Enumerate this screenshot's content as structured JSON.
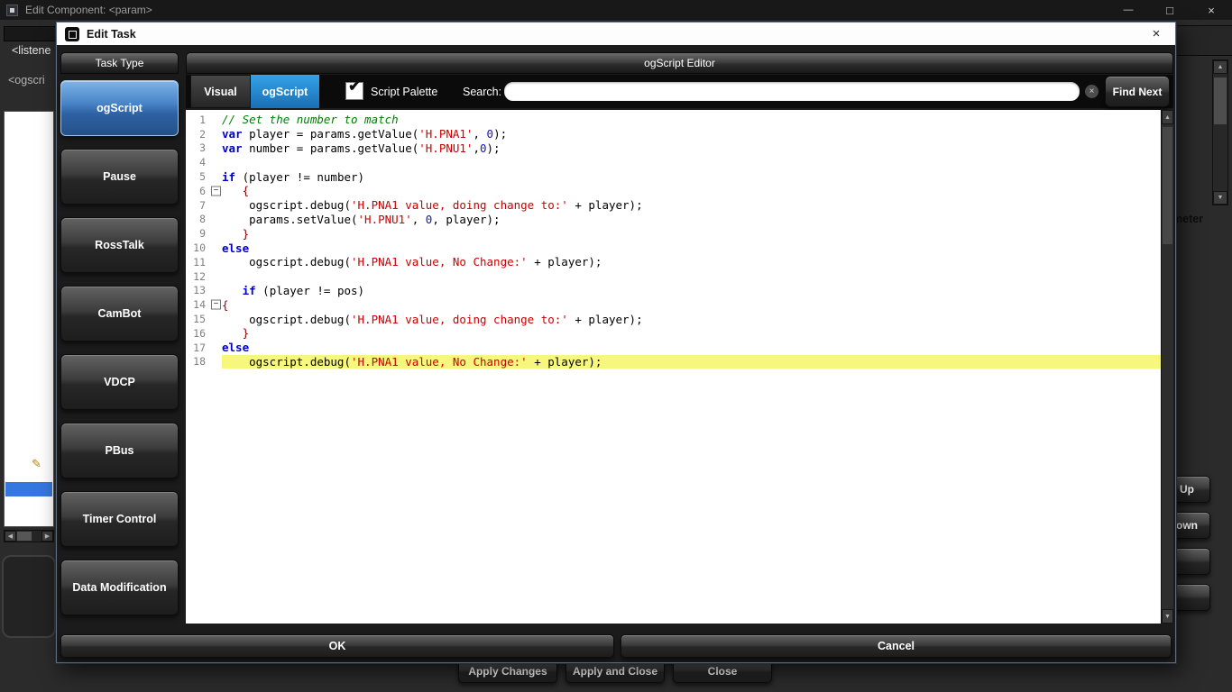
{
  "window": {
    "title": "Edit Component: <param>",
    "controls": {
      "minimize": "—",
      "maximize": "□",
      "close": "×"
    }
  },
  "icons": {
    "check": "✔",
    "clear": "×",
    "dialog_close": "×",
    "scroll_up": "▲",
    "scroll_down": "▼",
    "scroll_left": "◀",
    "scroll_right": "▶",
    "pencil": "✎"
  },
  "background": {
    "listener_text": "<listene",
    "ogscript_text": "<ogscri",
    "meter_text": "meter",
    "up_button": "Up",
    "down_button": "own",
    "bottom_buttons": [
      "Apply Changes",
      "Apply and Close",
      "Close"
    ]
  },
  "dialog": {
    "title": "Edit Task",
    "sidebar": {
      "header": "Task Type",
      "items": [
        {
          "label": "ogScript",
          "selected": true
        },
        {
          "label": "Pause",
          "selected": false
        },
        {
          "label": "RossTalk",
          "selected": false
        },
        {
          "label": "CamBot",
          "selected": false
        },
        {
          "label": "VDCP",
          "selected": false
        },
        {
          "label": "PBus",
          "selected": false
        },
        {
          "label": "Timer Control",
          "selected": false
        },
        {
          "label": "Data Modification",
          "selected": false
        }
      ]
    },
    "editor": {
      "header": "ogScript Editor",
      "tabs": [
        {
          "label": "Visual",
          "selected": false
        },
        {
          "label": "ogScript",
          "selected": true
        }
      ],
      "script_palette": {
        "label": "Script Palette",
        "checked": true
      },
      "search": {
        "label": "Search:",
        "value": ""
      },
      "find_next": "Find Next",
      "code": {
        "lines": [
          {
            "n": 1,
            "tokens": [
              [
                "cm",
                "// Set the number to match"
              ]
            ]
          },
          {
            "n": 2,
            "tokens": [
              [
                "kw",
                "var"
              ],
              [
                "pl",
                " player = params.getValue("
              ],
              [
                "str",
                "'H.PNA1'"
              ],
              [
                "pl",
                ", "
              ],
              [
                "num",
                "0"
              ],
              [
                "pl",
                ");"
              ]
            ]
          },
          {
            "n": 3,
            "tokens": [
              [
                "kw",
                "var"
              ],
              [
                "pl",
                " number = params.getValue("
              ],
              [
                "str",
                "'H.PNU1'"
              ],
              [
                "pl",
                ","
              ],
              [
                "num",
                "0"
              ],
              [
                "pl",
                ");"
              ]
            ]
          },
          {
            "n": 4,
            "tokens": []
          },
          {
            "n": 5,
            "tokens": [
              [
                "kw",
                "if"
              ],
              [
                "pl",
                " (player != number)"
              ]
            ]
          },
          {
            "n": 6,
            "fold": true,
            "tokens": [
              [
                "pn",
                "   {"
              ]
            ]
          },
          {
            "n": 7,
            "tokens": [
              [
                "pl",
                "    ogscript.debug("
              ],
              [
                "str",
                "'H.PNA1 value, doing change to:'"
              ],
              [
                "pl",
                " + player);"
              ]
            ]
          },
          {
            "n": 8,
            "tokens": [
              [
                "pl",
                "    params.setValue("
              ],
              [
                "str",
                "'H.PNU1'"
              ],
              [
                "pl",
                ", "
              ],
              [
                "num",
                "0"
              ],
              [
                "pl",
                ", player);"
              ]
            ]
          },
          {
            "n": 9,
            "tokens": [
              [
                "pn",
                "   }"
              ]
            ]
          },
          {
            "n": 10,
            "tokens": [
              [
                "kw",
                "else"
              ]
            ]
          },
          {
            "n": 11,
            "tokens": [
              [
                "pl",
                "    ogscript.debug("
              ],
              [
                "str",
                "'H.PNA1 value, No Change:'"
              ],
              [
                "pl",
                " + player);"
              ]
            ]
          },
          {
            "n": 12,
            "tokens": []
          },
          {
            "n": 13,
            "tokens": [
              [
                "pl",
                "   "
              ],
              [
                "kw",
                "if"
              ],
              [
                "pl",
                " (player != pos)"
              ]
            ]
          },
          {
            "n": 14,
            "fold": true,
            "tokens": [
              [
                "pn",
                "{"
              ]
            ]
          },
          {
            "n": 15,
            "tokens": [
              [
                "pl",
                "    ogscript.debug("
              ],
              [
                "str",
                "'H.PNA1 value, doing change to:'"
              ],
              [
                "pl",
                " + player);"
              ]
            ]
          },
          {
            "n": 16,
            "tokens": [
              [
                "pn",
                "   }"
              ]
            ]
          },
          {
            "n": 17,
            "tokens": [
              [
                "kw",
                "else"
              ]
            ]
          },
          {
            "n": 18,
            "highlight": true,
            "tokens": [
              [
                "pl",
                "    ogscript.debug("
              ],
              [
                "str",
                "'H.PNA1 value, No Change:'"
              ],
              [
                "pl",
                " + player);"
              ]
            ]
          }
        ]
      }
    },
    "footer": {
      "ok": "OK",
      "cancel": "Cancel"
    }
  },
  "colors": {
    "selected_task_blue": "#3c74b8",
    "tab_blue": "#1e87d0",
    "line_highlight": "#f7f77e",
    "keyword": "#0000c8",
    "comment": "#007d00",
    "string": "#c80000",
    "number": "#1616b4",
    "separator": "#8b0000"
  }
}
